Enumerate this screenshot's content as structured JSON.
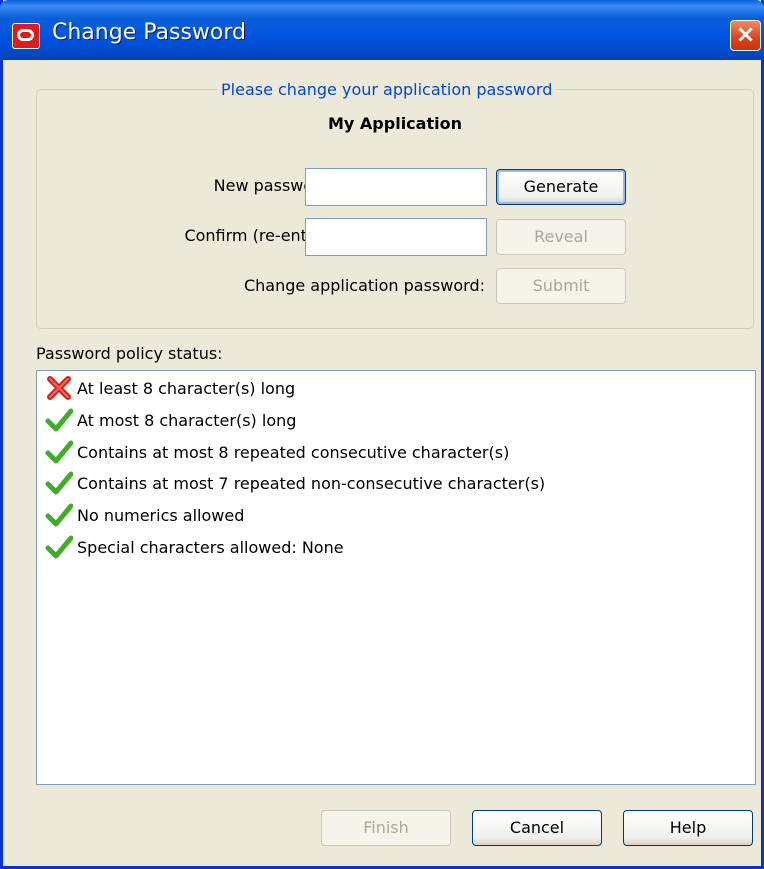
{
  "window": {
    "title": "Change Password",
    "close_label": "×"
  },
  "group": {
    "legend": "Please change your application password",
    "app_name": "My Application"
  },
  "form": {
    "new_password_label": "New password:",
    "new_password_value": "",
    "confirm_label": "Confirm (re-enter):",
    "confirm_value": "",
    "change_label": "Change application password:",
    "generate_label": "Generate",
    "reveal_label": "Reveal",
    "submit_label": "Submit"
  },
  "policy": {
    "label": "Password policy status:",
    "items": [
      {
        "text": "At least 8 character(s) long",
        "status": "fail",
        "icon": "cross-icon"
      },
      {
        "text": "At most 8 character(s) long",
        "status": "pass",
        "icon": "check-icon"
      },
      {
        "text": "Contains at most 8 repeated consecutive character(s)",
        "status": "pass",
        "icon": "check-icon"
      },
      {
        "text": "Contains at most 7 repeated non-consecutive character(s)",
        "status": "pass",
        "icon": "check-icon"
      },
      {
        "text": "No numerics allowed",
        "status": "pass",
        "icon": "check-icon"
      },
      {
        "text": "Special characters allowed: None",
        "status": "pass",
        "icon": "check-icon"
      }
    ]
  },
  "footer": {
    "finish_label": "Finish",
    "cancel_label": "Cancel",
    "help_label": "Help"
  },
  "colors": {
    "titlebar": "#0054e3",
    "legend_text": "#0046d5",
    "fail": "#d61f1f",
    "pass": "#3fae25"
  }
}
